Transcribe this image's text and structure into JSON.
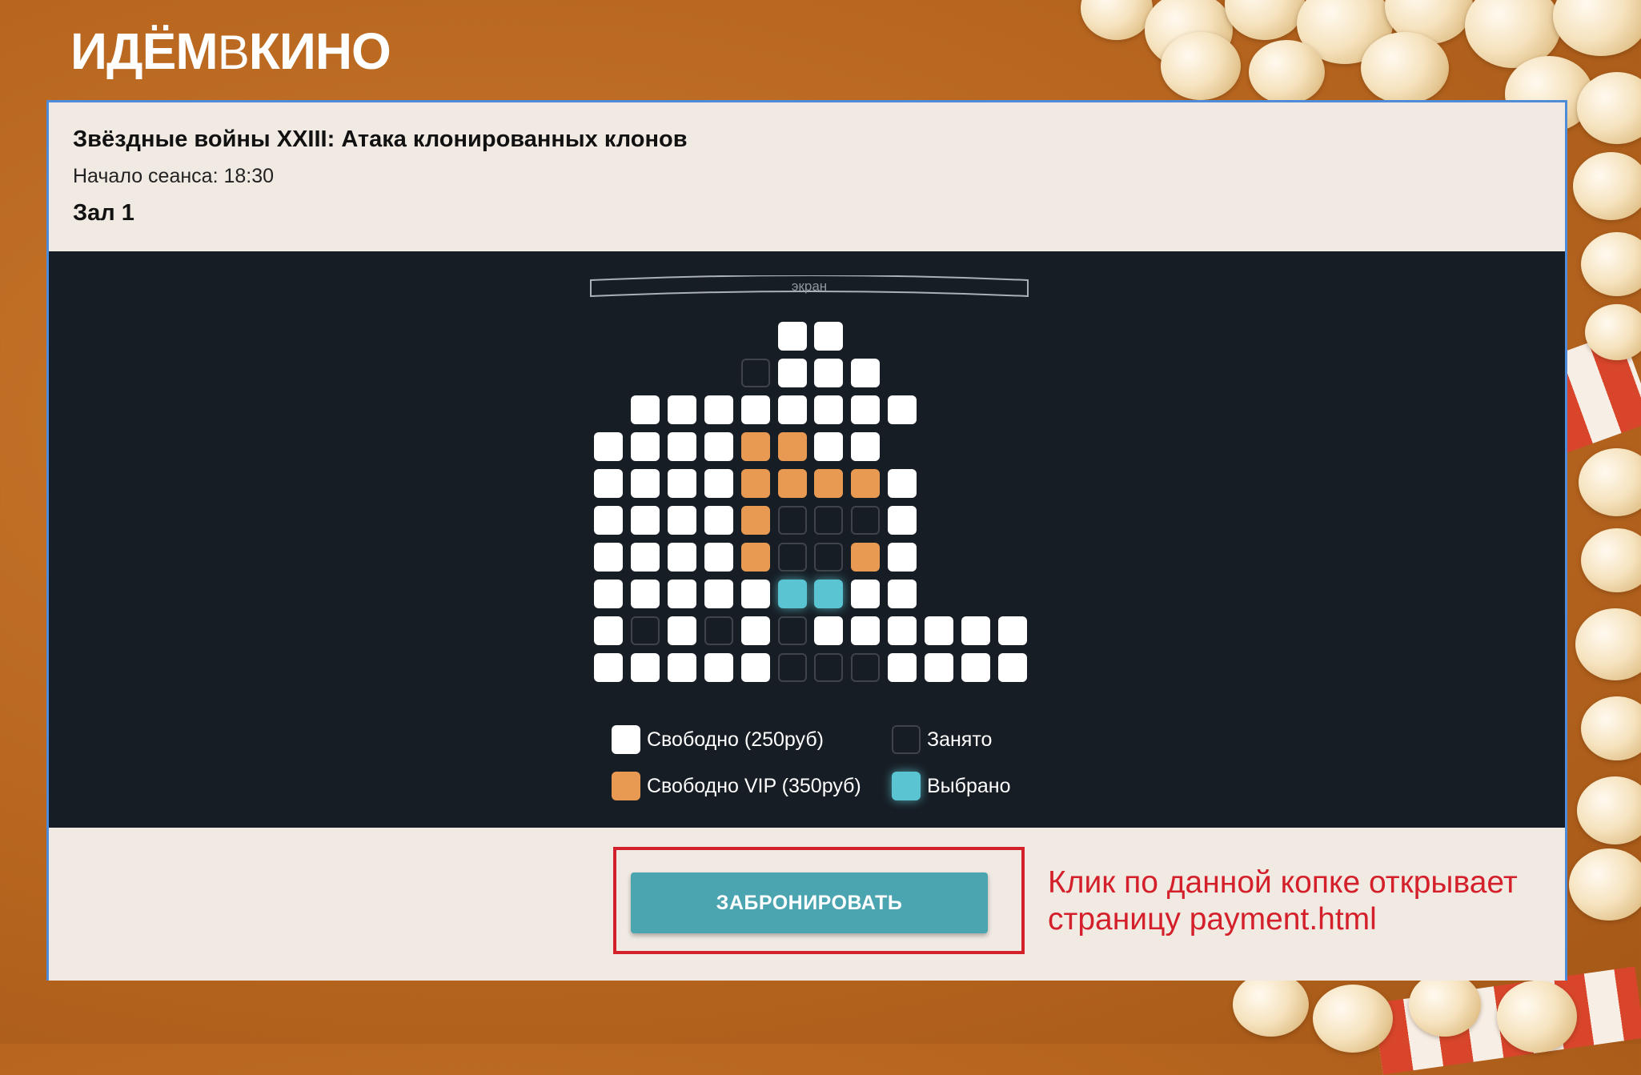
{
  "brand": {
    "name_bold_1": "ИДЁМ",
    "name_thin": "В",
    "name_bold_2": "КИНО"
  },
  "session": {
    "movie_title": "Звёздные войны XXIII: Атака клонированных клонов",
    "start_time": "Начало сеанса: 18:30",
    "hall": "Зал 1"
  },
  "screen_label": "экран",
  "seat_rows": [
    "......FF....",
    ".....TFFF...",
    "..FFFFFFFF..",
    ".FFFFVVFF...",
    ".FFFFVVVVF..",
    ".FFFFVTTTF..",
    ".FFFFVTTVF..",
    ".FFFFFSSFF..",
    ".FTFTFTFFFFFF",
    ".FFFFFTTTFFFF"
  ],
  "legend": {
    "free": "Свободно (250руб)",
    "taken": "Занято",
    "vip": "Свободно VIP (350руб)",
    "selected": "Выбрано"
  },
  "book_button": "ЗАБРОНИРОВАТЬ",
  "annotation": "Клик по данной копке открывает страницу payment.html",
  "colors": {
    "background": "#b8661f",
    "hall_background": "#171d24",
    "panel_background": "#f1eae3",
    "seat_free": "#ffffff",
    "seat_vip": "#e89a52",
    "seat_selected": "#5bc4d2",
    "seat_taken_border": "#3e444a",
    "button": "#4ba5b0",
    "annotation": "#d4202a",
    "card_border": "#4e8bd9"
  }
}
